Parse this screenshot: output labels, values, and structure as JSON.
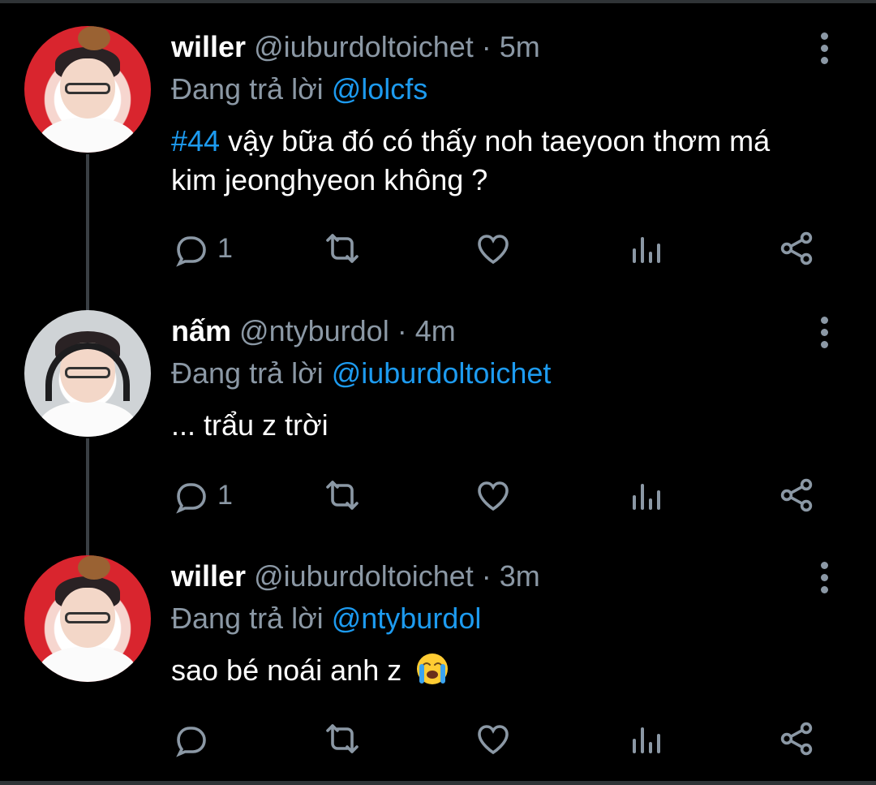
{
  "reply_prefix": "Đang trả lời",
  "icons": [
    "reply-icon",
    "retweet-icon",
    "like-icon",
    "analytics-icon",
    "share-icon",
    "more-options-icon"
  ],
  "colors": {
    "background": "#000000",
    "link": "#1d9bf0",
    "muted": "#8b98a5"
  },
  "tweets": [
    {
      "name": "willer",
      "handle": "@iuburdoltoichet",
      "time": "5m",
      "reply_to": "@lolcfs",
      "hashtag": "#44",
      "text": " vậy bữa đó có thấy noh taeyoon thơm má kim jeonghyeon không ?",
      "reply_count": "1"
    },
    {
      "name": "nấm",
      "handle": "@ntyburdol",
      "time": "4m",
      "reply_to": "@iuburdoltoichet",
      "text": "... trẩu z trời",
      "reply_count": "1"
    },
    {
      "name": "willer",
      "handle": "@iuburdoltoichet",
      "time": "3m",
      "reply_to": "@ntyburdol",
      "text": "sao bé noái anh z",
      "emoji": "loudly-crying-face",
      "reply_count": ""
    }
  ]
}
